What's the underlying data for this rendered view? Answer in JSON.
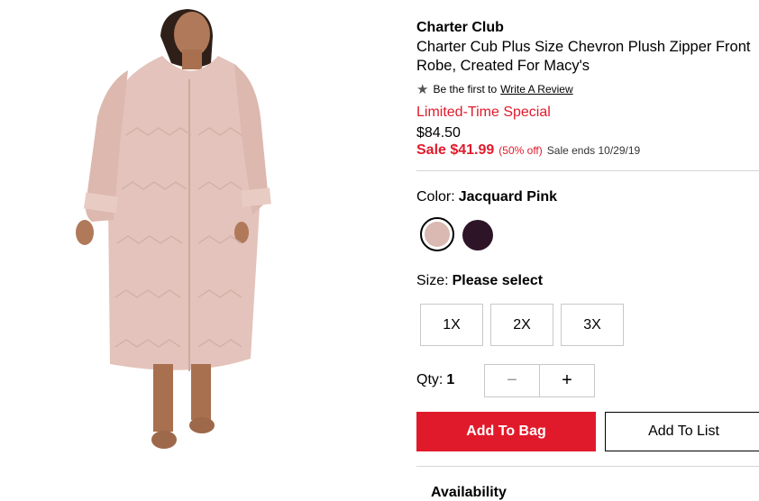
{
  "product": {
    "brand": "Charter Club",
    "title": "Charter Cub Plus Size Chevron Plush Zipper Front Robe, Created For Macy's"
  },
  "review": {
    "prompt": "Be the first to",
    "link": "Write A Review"
  },
  "pricing": {
    "promo": "Limited-Time Special",
    "original": "$84.50",
    "sale": "Sale $41.99",
    "discount": "(50% off)",
    "sale_ends": "Sale ends 10/29/19"
  },
  "color": {
    "label": "Color:",
    "selected": "Jacquard Pink",
    "swatches": [
      {
        "name": "Jacquard Pink",
        "hex": "#d9b9b1"
      },
      {
        "name": "Dark Purple",
        "hex": "#2d1427"
      }
    ]
  },
  "size": {
    "label": "Size:",
    "selected": "Please select",
    "options": [
      "1X",
      "2X",
      "3X"
    ]
  },
  "quantity": {
    "label": "Qty:",
    "value": "1",
    "minus": "−",
    "plus": "+"
  },
  "actions": {
    "add_to_bag": "Add To Bag",
    "add_to_list": "Add To List"
  },
  "availability": {
    "label": "Availability"
  },
  "colors": {
    "accent": "#e11a2b",
    "robe": "#e3c3bb"
  }
}
